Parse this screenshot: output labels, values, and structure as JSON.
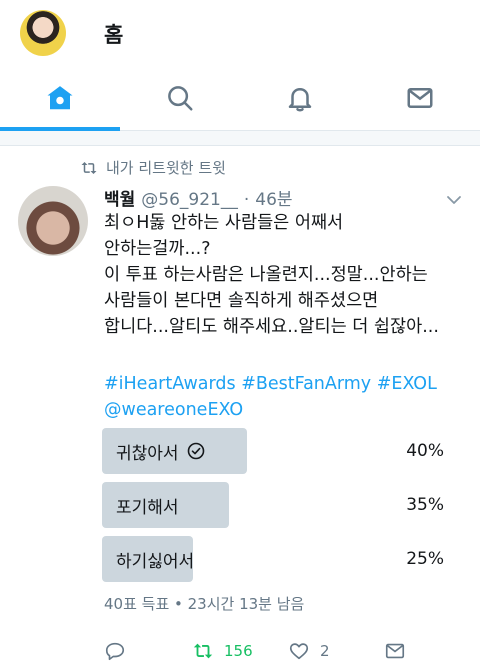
{
  "header": {
    "title": "홈"
  },
  "tabs": [
    {
      "name": "home",
      "active": true
    },
    {
      "name": "search",
      "active": false
    },
    {
      "name": "notifications",
      "active": false
    },
    {
      "name": "messages",
      "active": false
    }
  ],
  "colors": {
    "accent": "#1da1f2",
    "muted": "#657786",
    "retweet_green": "#17bf63",
    "poll_fill": "#ccd6dd"
  },
  "tweet": {
    "context": "내가 리트윗한 트윗",
    "author": "백월",
    "handle": "@56_921__",
    "dot": "·",
    "time": "46분",
    "text": "최ㅇH돓 안하는 사람들은 어째서\n안하는걸까...?\n이 투표 하는사람은 나올련지...정말...안하는\n사람들이 본다면 솔직하게 해주셨으면\n합니다...알티도 해주세요..알티는 더 쉽잖아...",
    "hashtags": "#iHeartAwards #BestFanArmy #EXOL @weareoneEXO",
    "poll": {
      "options": [
        {
          "label": "귀찮아서",
          "percent": "40%",
          "value": 0.4,
          "chosen": true
        },
        {
          "label": "포기해서",
          "percent": "35%",
          "value": 0.35,
          "chosen": false
        },
        {
          "label": "하기싫어서",
          "percent": "25%",
          "value": 0.25,
          "chosen": false
        }
      ],
      "meta": "40표 득표 • 23시간 13분  남음"
    },
    "actions": {
      "retweets": "156",
      "likes": "2"
    }
  }
}
